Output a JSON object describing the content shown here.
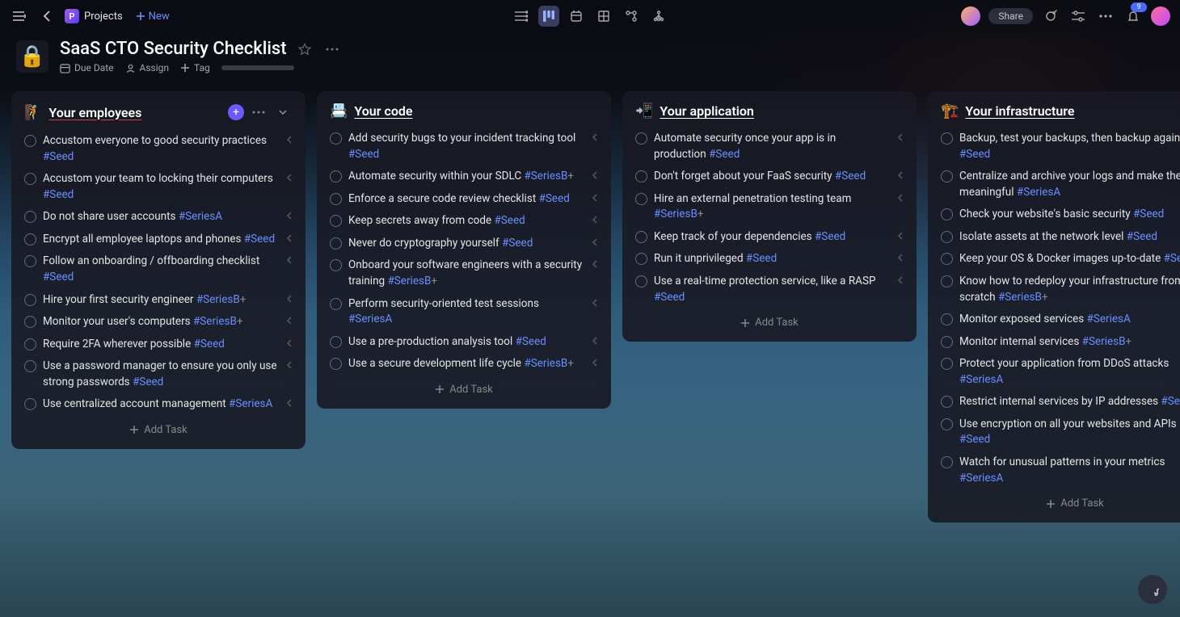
{
  "topbar": {
    "projects_label": "Projects",
    "project_initial": "P",
    "new_label": "New",
    "share_label": "Share",
    "notification_count": "9"
  },
  "page": {
    "icon": "🔒",
    "title": "SaaS CTO Security Checklist",
    "meta": {
      "due_date": "Due Date",
      "assign": "Assign",
      "tag": "Tag"
    }
  },
  "board": {
    "add_task_label": "Add Task",
    "columns": [
      {
        "emoji": "🧗",
        "title": "Your employees",
        "title_style": "red",
        "hovered": true,
        "tasks": [
          {
            "text": "Accustom everyone to good security practices",
            "tags": [
              "#Seed"
            ]
          },
          {
            "text": "Accustom your team to locking their computers",
            "tags": [
              "#Seed"
            ]
          },
          {
            "text": "Do not share user accounts",
            "tags": [
              "#SeriesA"
            ]
          },
          {
            "text": "Encrypt all employee laptops and phones",
            "tags": [
              "#Seed"
            ]
          },
          {
            "text": "Follow an onboarding / offboarding checklist",
            "tags": [
              "#Seed"
            ]
          },
          {
            "text": "Hire your first security engineer",
            "tags": [
              "#SeriesB"
            ],
            "plus": true
          },
          {
            "text": "Monitor your user's computers",
            "tags": [
              "#SeriesB"
            ],
            "plus": true
          },
          {
            "text": "Require 2FA wherever possible",
            "tags": [
              "#Seed"
            ]
          },
          {
            "text": "Use a password manager to ensure you only use strong passwords",
            "tags": [
              "#Seed"
            ]
          },
          {
            "text": "Use centralized account management",
            "tags": [
              "#SeriesA"
            ]
          }
        ]
      },
      {
        "emoji": "📇",
        "title": "Your code",
        "tasks": [
          {
            "text": "Add security bugs to your incident tracking tool",
            "tags": [
              "#Seed"
            ]
          },
          {
            "text": "Automate security within your SDLC",
            "tags": [
              "#SeriesB"
            ],
            "plus": true
          },
          {
            "text": "Enforce a secure code review checklist",
            "tags": [
              "#Seed"
            ]
          },
          {
            "text": "Keep secrets away from code",
            "tags": [
              "#Seed"
            ]
          },
          {
            "text": "Never do cryptography yourself",
            "tags": [
              "#Seed"
            ]
          },
          {
            "text": "Onboard your software engineers with a security training",
            "tags": [
              "#SeriesB"
            ],
            "plus": true
          },
          {
            "text": "Perform security-oriented test sessions",
            "tags": [
              "#SeriesA"
            ]
          },
          {
            "text": "Use a pre-production analysis tool",
            "tags": [
              "#Seed"
            ]
          },
          {
            "text": "Use a secure development life cycle",
            "tags": [
              "#SeriesB"
            ],
            "plus": true
          }
        ]
      },
      {
        "emoji": "📲",
        "title": "Your application",
        "tasks": [
          {
            "text": "Automate security once your app is in production",
            "tags": [
              "#Seed"
            ]
          },
          {
            "text": "Don't forget about your FaaS security",
            "tags": [
              "#Seed"
            ]
          },
          {
            "text": "Hire an external penetration testing team",
            "tags": [
              "#SeriesB"
            ],
            "plus": true
          },
          {
            "text": "Keep track of your dependencies",
            "tags": [
              "#Seed"
            ]
          },
          {
            "text": "Run it unprivileged",
            "tags": [
              "#Seed"
            ]
          },
          {
            "text": "Use a real-time protection service, like a RASP",
            "tags": [
              "#Seed"
            ]
          }
        ]
      },
      {
        "emoji": "🏗️",
        "title": "Your infrastructure",
        "no_chevron": true,
        "tasks": [
          {
            "text": "Backup, test your backups, then backup again",
            "tags": [
              "#Seed"
            ]
          },
          {
            "text": "Centralize and archive your logs and make them meaningful",
            "tags": [
              "#SeriesA"
            ]
          },
          {
            "text": "Check your website's basic security",
            "tags": [
              "#Seed"
            ]
          },
          {
            "text": "Isolate assets at the network level",
            "tags": [
              "#Seed"
            ]
          },
          {
            "text": "Keep your OS & Docker images up-to-date",
            "tags": [
              "#Seed"
            ]
          },
          {
            "text": "Know how to redeploy your infrastructure from scratch",
            "tags": [
              "#SeriesB"
            ],
            "plus": true
          },
          {
            "text": "Monitor exposed services",
            "tags": [
              "#SeriesA"
            ]
          },
          {
            "text": "Monitor internal services",
            "tags": [
              "#SeriesB"
            ],
            "plus": true
          },
          {
            "text": "Protect your application from DDoS attacks",
            "tags": [
              "#SeriesA"
            ]
          },
          {
            "text": "Restrict internal services by IP addresses",
            "tags": [
              "#SeriesA"
            ]
          },
          {
            "text": "Use encryption on all your websites and APIs",
            "tags": [
              "#Seed"
            ]
          },
          {
            "text": "Watch for unusual patterns in your metrics",
            "tags": [
              "#SeriesA"
            ]
          }
        ]
      }
    ]
  }
}
